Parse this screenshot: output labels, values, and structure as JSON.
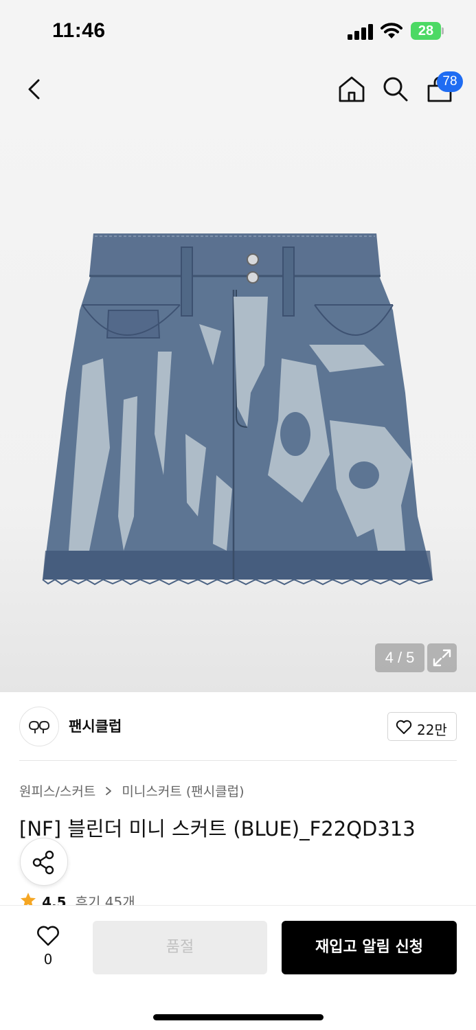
{
  "status_bar": {
    "time": "11:46",
    "battery": "28",
    "icons": [
      "cellular-signal-icon",
      "wifi-icon",
      "battery-charging-icon"
    ]
  },
  "header": {
    "icons": [
      "back-icon",
      "home-icon",
      "search-icon",
      "shopping-bag-icon"
    ],
    "cart_count": "78"
  },
  "gallery": {
    "page_indicator": "4 / 5",
    "current_page": 4,
    "total_pages": 5,
    "expand_icon": "expand-icon"
  },
  "brand": {
    "name": "팬시클럽",
    "logo_icon": "brand-logo-icon",
    "like_count": "22만"
  },
  "product": {
    "breadcrumb": [
      "원피스/스커트",
      "미니스커트 (팬시클럽)"
    ],
    "title": "[NF] 블린더 미니 스커트 (BLUE)_F22QD313",
    "rating": "4.5",
    "reviews": "후기 45개"
  },
  "bottom_bar": {
    "wish_count": "0",
    "soldout_label": "품절",
    "restock_label": "재입고 알림 신청"
  },
  "colors": {
    "accent_badge": "#1f6cf2",
    "star": "#f5a623",
    "primary_button": "#000000",
    "disabled_button": "#ececec"
  }
}
